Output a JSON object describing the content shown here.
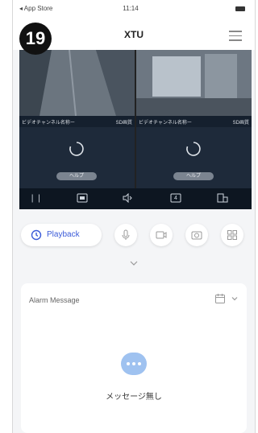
{
  "step_badge": "19",
  "status_bar": {
    "back_text": "◂ App Store",
    "time": "11:14"
  },
  "header": {
    "title": "XTU"
  },
  "cameras": [
    {
      "name": "ビデオチャンネル名称ー",
      "quality": "SD画質",
      "tag": "ヘルプ"
    },
    {
      "name": "ビデオチャンネル名称ー",
      "quality": "SD画質",
      "tag": "ヘルプ"
    }
  ],
  "toolbar": {
    "split_number": "4"
  },
  "controls": {
    "playback_label": "Playback"
  },
  "alarm": {
    "title": "Alarm Message",
    "empty_text": "メッセージ無し"
  },
  "colors": {
    "accent": "#3b5bd8",
    "empty_icon": "#9fc2f0",
    "video_bg": "#1e2a3a"
  }
}
